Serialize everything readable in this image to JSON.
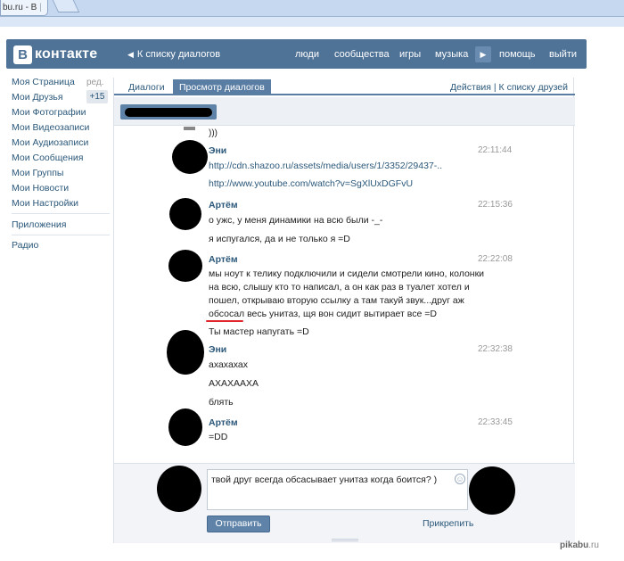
{
  "browser": {
    "tab_title": "bu.ru - B",
    "tab_separator": "|"
  },
  "header": {
    "logo_letter": "B",
    "logo_text": "контакте",
    "back_arrow": "◀",
    "back_label": "К списку диалогов",
    "nav": [
      "люди",
      "сообщества",
      "игры",
      "музыка",
      "помощь",
      "выйти"
    ],
    "play_icon": "▶"
  },
  "left_menu": {
    "edit_label": "ред.",
    "friends_badge": "+15",
    "items": [
      "Моя Страница",
      "Мои Друзья",
      "Мои Фотографии",
      "Мои Видеозаписи",
      "Мои Аудиозаписи",
      "Мои Сообщения",
      "Мои Группы",
      "Мои Новости",
      "Мои Настройки"
    ],
    "extra_items": [
      "Приложения",
      "Радио"
    ]
  },
  "tabs": {
    "dialogs": "Диалоги",
    "view_dialogs": "Просмотр диалогов",
    "actions": "Действия",
    "divider": "|",
    "back_to_friends": "К списку друзей"
  },
  "previous_message_tail": ")))",
  "messages": [
    {
      "author": "Эни",
      "time": "22:11:44",
      "lines": [
        {
          "text": "http://cdn.shazoo.ru/assets/media/users/1/3352/29437-..",
          "link": true
        },
        {
          "text": "http://www.youtube.com/watch?v=SgXlUxDGFvU",
          "link": true
        }
      ]
    },
    {
      "author": "Артём",
      "time": "22:15:36",
      "lines": [
        {
          "text": "о ужс, у меня динамики на всю были -_-",
          "link": false
        },
        {
          "text": "я испугался, да и не только я =D",
          "link": false
        }
      ]
    },
    {
      "author": "Артём",
      "time": "22:22:08",
      "lines": [
        {
          "text": "мы ноут к телику подключили и сидели смотрели кино, колонки",
          "link": false
        },
        {
          "text": "на всю, слышу кто то написал, а он как раз в туалет хотел и",
          "link": false
        },
        {
          "text": "пошел, открываю вторую ссылку а там такуй звук...друг аж",
          "link": false
        },
        {
          "text": "обсосал весь унитаз, щя вон сидит вытирает все =D",
          "link": false
        },
        {
          "text": "Ты мастер напугать =D",
          "link": false
        }
      ]
    },
    {
      "author": "Эни",
      "time": "22:32:38",
      "lines": [
        {
          "text": "ахахахах",
          "link": false
        },
        {
          "text": "АХАХААХА",
          "link": false
        },
        {
          "text": "блять",
          "link": false
        }
      ]
    },
    {
      "author": "Артём",
      "time": "22:33:45",
      "lines": [
        {
          "text": "=DD",
          "link": false
        }
      ]
    }
  ],
  "composer": {
    "draft": "твой друг всегда обсасывает унитаз когда боится? )",
    "smile_icon": "☺",
    "send_label": "Отправить",
    "attach_label": "Прикрепить"
  },
  "footer": {
    "brand_bold": "pikabu",
    "brand_rest": ".ru"
  },
  "colors": {
    "vk_blue": "#4f7297",
    "link": "#2b587a",
    "underline_red": "#e0262b"
  }
}
